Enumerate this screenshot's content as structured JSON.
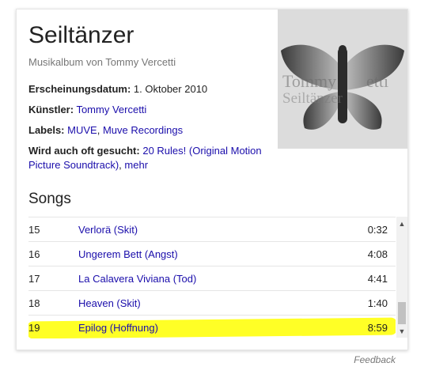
{
  "album": {
    "title": "Seiltänzer",
    "subtitle": "Musikalbum von Tommy Vercetti",
    "art_text": "Tommy Vercetti Seiltänzer"
  },
  "facts": {
    "release_label": "Erscheinungsdatum:",
    "release_value": "1. Oktober 2010",
    "artist_label": "Künstler:",
    "artist_value": "Tommy Vercetti",
    "labels_label": "Labels:",
    "labels_value_1": "MUVE",
    "labels_sep": ", ",
    "labels_value_2": "Muve Recordings",
    "also_searched_label": "Wird auch oft gesucht:",
    "also_searched_value": "20 Rules! (Original Motion Picture Soundtrack)",
    "also_searched_sep": ", ",
    "also_searched_more": "mehr"
  },
  "songs": {
    "heading": "Songs",
    "rows": [
      {
        "num": "15",
        "name": "Verlorä (Skit)",
        "duration": "0:32"
      },
      {
        "num": "16",
        "name": "Ungerem Bett (Angst)",
        "duration": "4:08"
      },
      {
        "num": "17",
        "name": "La Calavera Viviana (Tod)",
        "duration": "4:41"
      },
      {
        "num": "18",
        "name": "Heaven (Skit)",
        "duration": "1:40"
      },
      {
        "num": "19",
        "name": "Epilog (Hoffnung)",
        "duration": "8:59"
      }
    ]
  },
  "scrollbar": {
    "up_arrow": "▲",
    "down_arrow": "▼"
  },
  "feedback": "Feedback",
  "colors": {
    "link": "#1a0dab",
    "highlight": "#ffff26"
  }
}
